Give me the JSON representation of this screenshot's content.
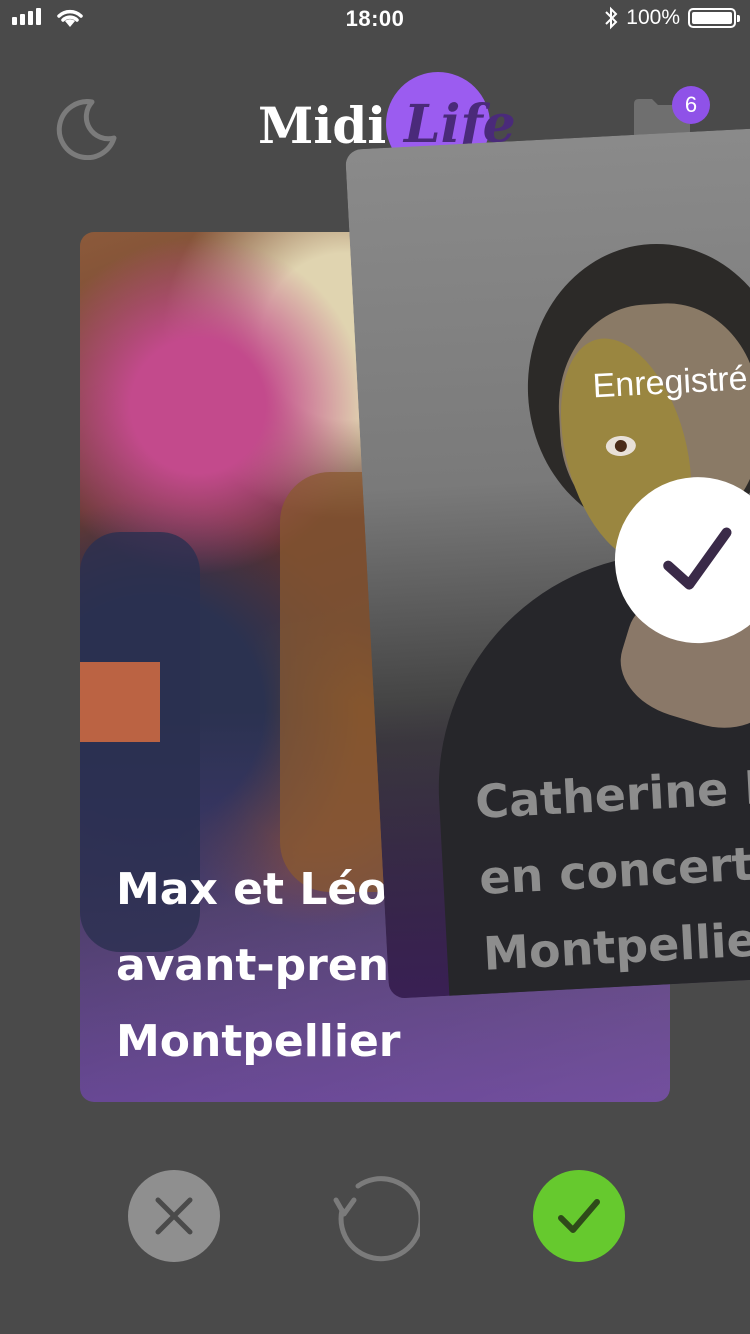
{
  "status_bar": {
    "time": "18:00",
    "battery": "100%",
    "battery_level": 1.0,
    "signal_bars": 4
  },
  "header": {
    "logo_left": "Midi",
    "logo_right": "Life",
    "night_mode_icon": "moon-icon",
    "saved_folder_icon": "folder-icon",
    "saved_count": "6"
  },
  "cards": {
    "back": {
      "title": "Max et Léo\navant-pren\nMontpellier"
    },
    "front": {
      "title": "Catherine R\nen concert à\nMontpellier",
      "saved_label": "Enregistré",
      "saved_icon": "check-icon"
    }
  },
  "actions": {
    "dislike_icon": "close-icon",
    "undo_icon": "undo-icon",
    "like_icon": "check-icon"
  },
  "colors": {
    "background": "#4a4a4a",
    "brand_purple": "#9b5cf0",
    "like_green": "#66c92e",
    "dislike_grey": "#8f8f8f"
  }
}
